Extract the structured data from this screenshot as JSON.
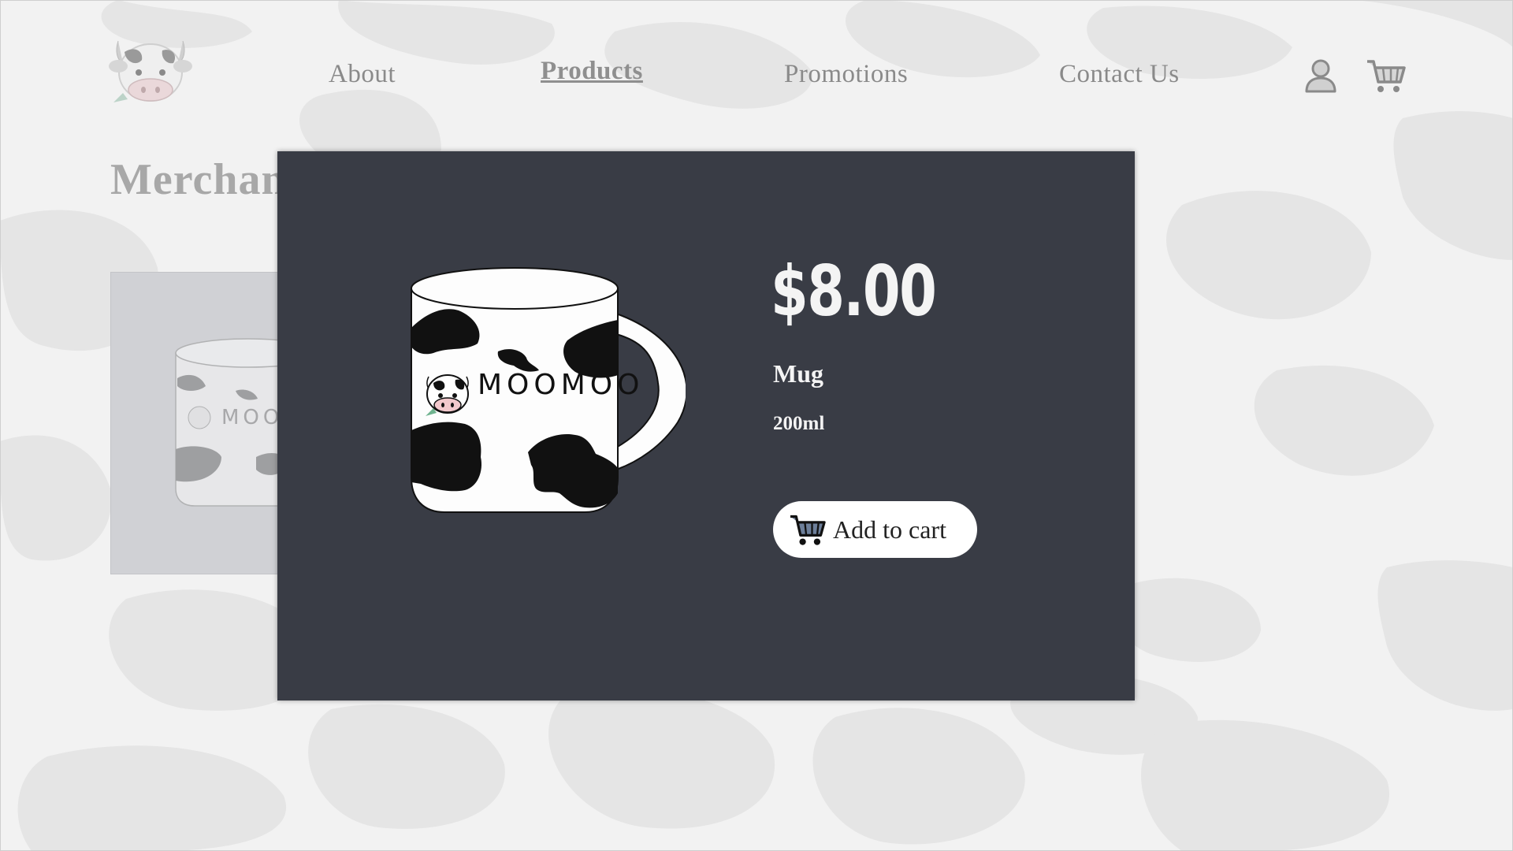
{
  "nav": {
    "items": [
      {
        "label": "About"
      },
      {
        "label": "Products"
      },
      {
        "label": "Promotions"
      },
      {
        "label": "Contact Us"
      }
    ],
    "active": "Products"
  },
  "page": {
    "title": "Merchandise"
  },
  "modal": {
    "price": "$8.00",
    "name": "Mug",
    "size": "200ml",
    "add_label": "Add to cart",
    "mug_print": "MOOMOO"
  },
  "icons": {
    "logo": "cow-logo-icon",
    "account": "user-icon",
    "cart": "shopping-cart-icon"
  },
  "colors": {
    "background": "#f2f2f2",
    "spots": "#e4e4e4",
    "modal": "#393c45",
    "text_on_modal": "#f4f4f4",
    "nav_text": "#8a8a8a"
  }
}
